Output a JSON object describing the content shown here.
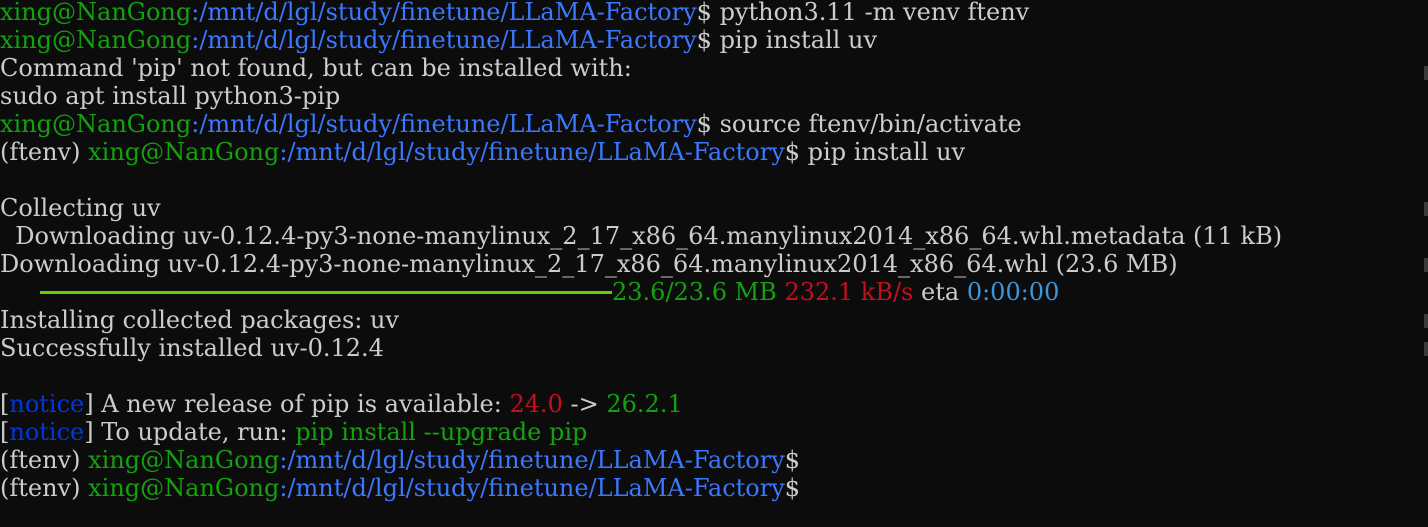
{
  "terminal": {
    "lines": [
      {
        "type": "prompt",
        "user_host": "xing@NanGong",
        "path": ":/mnt/d/lgl/study/finetune/LLaMA-Factory",
        "prompt_symbol": "$",
        "command": " python3.11 -m venv ftenv"
      },
      {
        "type": "prompt",
        "user_host": "xing@NanGong",
        "path": ":/mnt/d/lgl/study/finetune/LLaMA-Factory",
        "prompt_symbol": "$",
        "command": " pip install uv"
      },
      {
        "type": "text",
        "text": "Command 'pip' not found, but can be installed with:"
      },
      {
        "type": "text",
        "text": "sudo apt install python3-pip"
      },
      {
        "type": "prompt",
        "user_host": "xing@NanGong",
        "path": ":/mnt/d/lgl/study/finetune/LLaMA-Factory",
        "prompt_symbol": "$",
        "command": " source ftenv/bin/activate"
      },
      {
        "type": "venv-prompt",
        "venv": "(ftenv) ",
        "user_host": "xing@NanGong",
        "path": ":/mnt/d/lgl/study/finetune/LLaMA-Factory",
        "prompt_symbol": "$",
        "command": " pip install uv"
      },
      {
        "type": "text",
        "text": ""
      },
      {
        "type": "text",
        "text": "Collecting uv"
      },
      {
        "type": "text",
        "text": "  Downloading uv-0.12.4-py3-none-manylinux_2_17_x86_64.manylinux2014_x86_64.whl.metadata (11 kB)"
      },
      {
        "type": "text",
        "text": "Downloading uv-0.12.4-py3-none-manylinux_2_17_x86_64.manylinux2014_x86_64.whl (23.6 MB)"
      },
      {
        "type": "progress",
        "progress_fraction": 1.0,
        "size": "23.6/23.6 MB",
        "speed": "232.1 kB/s",
        "eta_label": "eta",
        "eta": "0:00:00"
      },
      {
        "type": "text",
        "text": "Installing collected packages: uv"
      },
      {
        "type": "text",
        "text": "Successfully installed uv-0.12.4"
      },
      {
        "type": "text",
        "text": ""
      },
      {
        "type": "notice",
        "open_bracket": "[",
        "tag": "notice",
        "close_bracket": "]",
        "message": " A new release of pip is available: ",
        "old_version": "24.0",
        "arrow": " -> ",
        "new_version": "26.2.1"
      },
      {
        "type": "notice-cmd",
        "open_bracket": "[",
        "tag": "notice",
        "close_bracket": "]",
        "message": " To update, run: ",
        "update_command": "pip install --upgrade pip"
      },
      {
        "type": "venv-prompt",
        "venv": "(ftenv) ",
        "user_host": "xing@NanGong",
        "path": ":/mnt/d/lgl/study/finetune/LLaMA-Factory",
        "prompt_symbol": "$",
        "command": ""
      },
      {
        "type": "venv-prompt",
        "venv": "(ftenv) ",
        "user_host": "xing@NanGong",
        "path": ":/mnt/d/lgl/study/finetune/LLaMA-Factory",
        "prompt_symbol": "$",
        "command": ""
      }
    ]
  },
  "colors": {
    "background": "#0c0c0c",
    "text": "#cccccc",
    "user_host": "#13a10e",
    "path": "#3b78ff",
    "progress_bar": "#61d000",
    "speed": "#c50f1f",
    "eta_value": "#3a96dd",
    "notice_tag": "#0037da",
    "old_version": "#c50f1f",
    "new_version": "#13a10e",
    "update_command": "#13a10e"
  }
}
